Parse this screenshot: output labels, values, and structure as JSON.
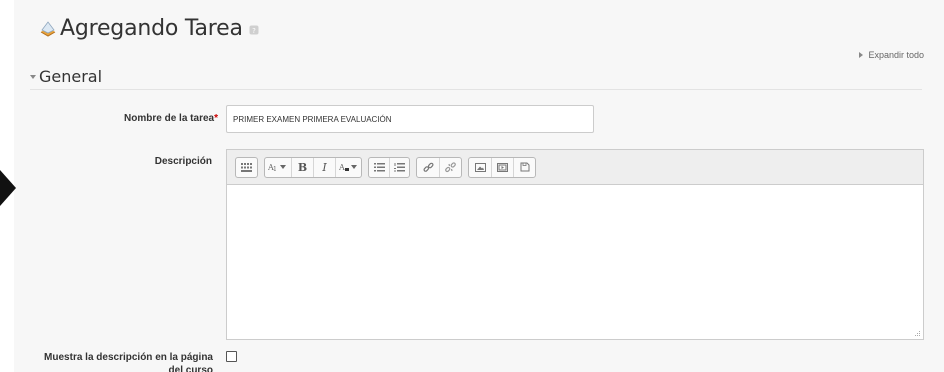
{
  "page": {
    "title": "Agregando Tarea",
    "expand_all": "Expandir todo"
  },
  "section": {
    "title": "General"
  },
  "form": {
    "task_name": {
      "label": "Nombre de la tarea",
      "required_marker": "*",
      "value": "PRIMER EXAMEN PRIMERA EVALUACIÓN"
    },
    "description": {
      "label": "Descripción",
      "toolbar_groups": [
        [
          "toolbar-toggle-icon"
        ],
        [
          "font-style-dropdown-icon",
          "bold-icon",
          "italic-icon",
          "font-color-dropdown-icon"
        ],
        [
          "unordered-list-icon",
          "ordered-list-icon"
        ],
        [
          "link-icon",
          "unlink-icon"
        ],
        [
          "image-icon",
          "media-icon",
          "manage-files-icon"
        ]
      ],
      "content": ""
    },
    "show_description": {
      "label": "Muestra la descripción en la página del curso",
      "checked": false
    }
  },
  "colors": {
    "panel_background": "#f7f7f7",
    "required": "#cc0000",
    "toolbar_background": "#eeeeee"
  }
}
